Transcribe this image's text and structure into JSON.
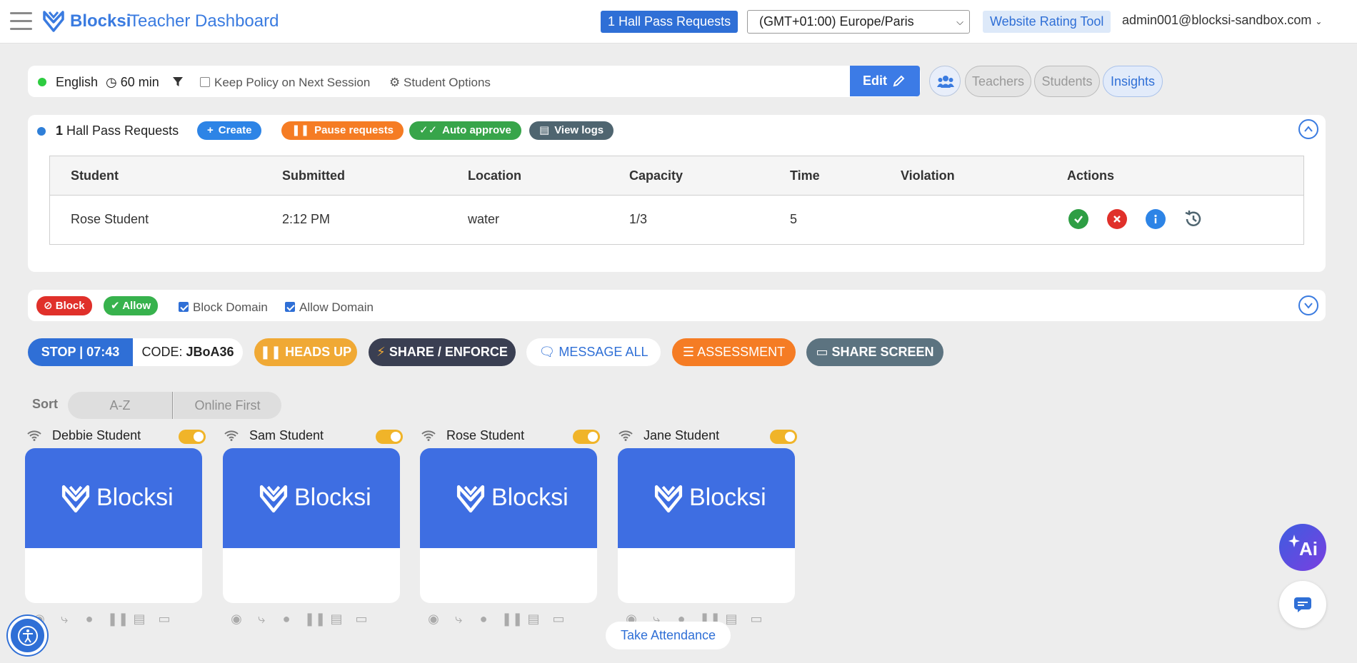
{
  "header": {
    "brand": "Blocksi",
    "title": "Teacher Dashboard",
    "hall_pass_badge": "1 Hall Pass Requests",
    "timezone": "(GMT+01:00) Europe/Paris",
    "rating_tool": "Website Rating Tool",
    "account": "admin001@blocksi-sandbox.com"
  },
  "policy": {
    "language": "English",
    "duration": "60 min",
    "keep_policy_label": "Keep Policy on Next Session",
    "keep_policy_checked": false,
    "student_options": "Student Options",
    "edit": "Edit",
    "tabs": [
      "Teachers",
      "Students",
      "Insights"
    ]
  },
  "hall_pass": {
    "count": "1",
    "title": "Hall Pass Requests",
    "buttons": {
      "create": "Create",
      "pause": "Pause requests",
      "auto": "Auto approve",
      "logs": "View logs"
    },
    "columns": [
      "Student",
      "Submitted",
      "Location",
      "Capacity",
      "Time",
      "Violation",
      "Actions"
    ],
    "rows": [
      {
        "student": "Rose Student",
        "submitted": "2:12 PM",
        "location": "water",
        "capacity": "1/3",
        "time": "5",
        "violation": ""
      }
    ]
  },
  "domains": {
    "block": "Block",
    "allow": "Allow",
    "block_domain": "Block Domain",
    "allow_domain": "Allow Domain",
    "block_domain_checked": true,
    "allow_domain_checked": true
  },
  "session": {
    "stop": "STOP | 07:43",
    "code_label": "CODE:",
    "code": "JBoA36",
    "heads_up": "HEADS UP",
    "share_enforce": "SHARE / ENFORCE",
    "message_all": "MESSAGE ALL",
    "assessment": "ASSESSMENT",
    "share_screen": "SHARE SCREEN"
  },
  "sort": {
    "label": "Sort",
    "options": [
      "A-Z",
      "Online First"
    ]
  },
  "students": [
    {
      "name": "Debbie Student",
      "online": true,
      "screen_brand": "Blocksi"
    },
    {
      "name": "Sam Student",
      "online": true,
      "screen_brand": "Blocksi"
    },
    {
      "name": "Rose Student",
      "online": true,
      "screen_brand": "Blocksi"
    },
    {
      "name": "Jane Student",
      "online": true,
      "screen_brand": "Blocksi"
    }
  ],
  "footer": {
    "take_attendance": "Take Attendance",
    "ai": "Ai"
  },
  "colors": {
    "brand_blue": "#2f6fd6",
    "stop_blue": "#2f6fd6",
    "heads_up": "#f0a935",
    "share_enforce": "#3a3f52",
    "assessment": "#f57c24",
    "share_screen": "#5c7380",
    "block": "#e0302a",
    "allow": "#37b24d",
    "toggle_on": "#f0b429",
    "tile_blue": "#3e6ee2"
  },
  "icons": [
    "hamburger-icon",
    "clock-icon",
    "filter-icon",
    "gear-icon",
    "pencil-icon",
    "group-icon",
    "plus-icon",
    "pause-icon",
    "double-check-icon",
    "document-icon",
    "check-icon",
    "close-icon",
    "info-icon",
    "history-icon",
    "chevron-up-icon",
    "chevron-down-icon",
    "ban-icon",
    "bolt-icon",
    "chat-icon",
    "list-icon",
    "cast-icon",
    "wifi-icon",
    "camera-icon",
    "accessibility-icon",
    "sparkle-icon"
  ]
}
